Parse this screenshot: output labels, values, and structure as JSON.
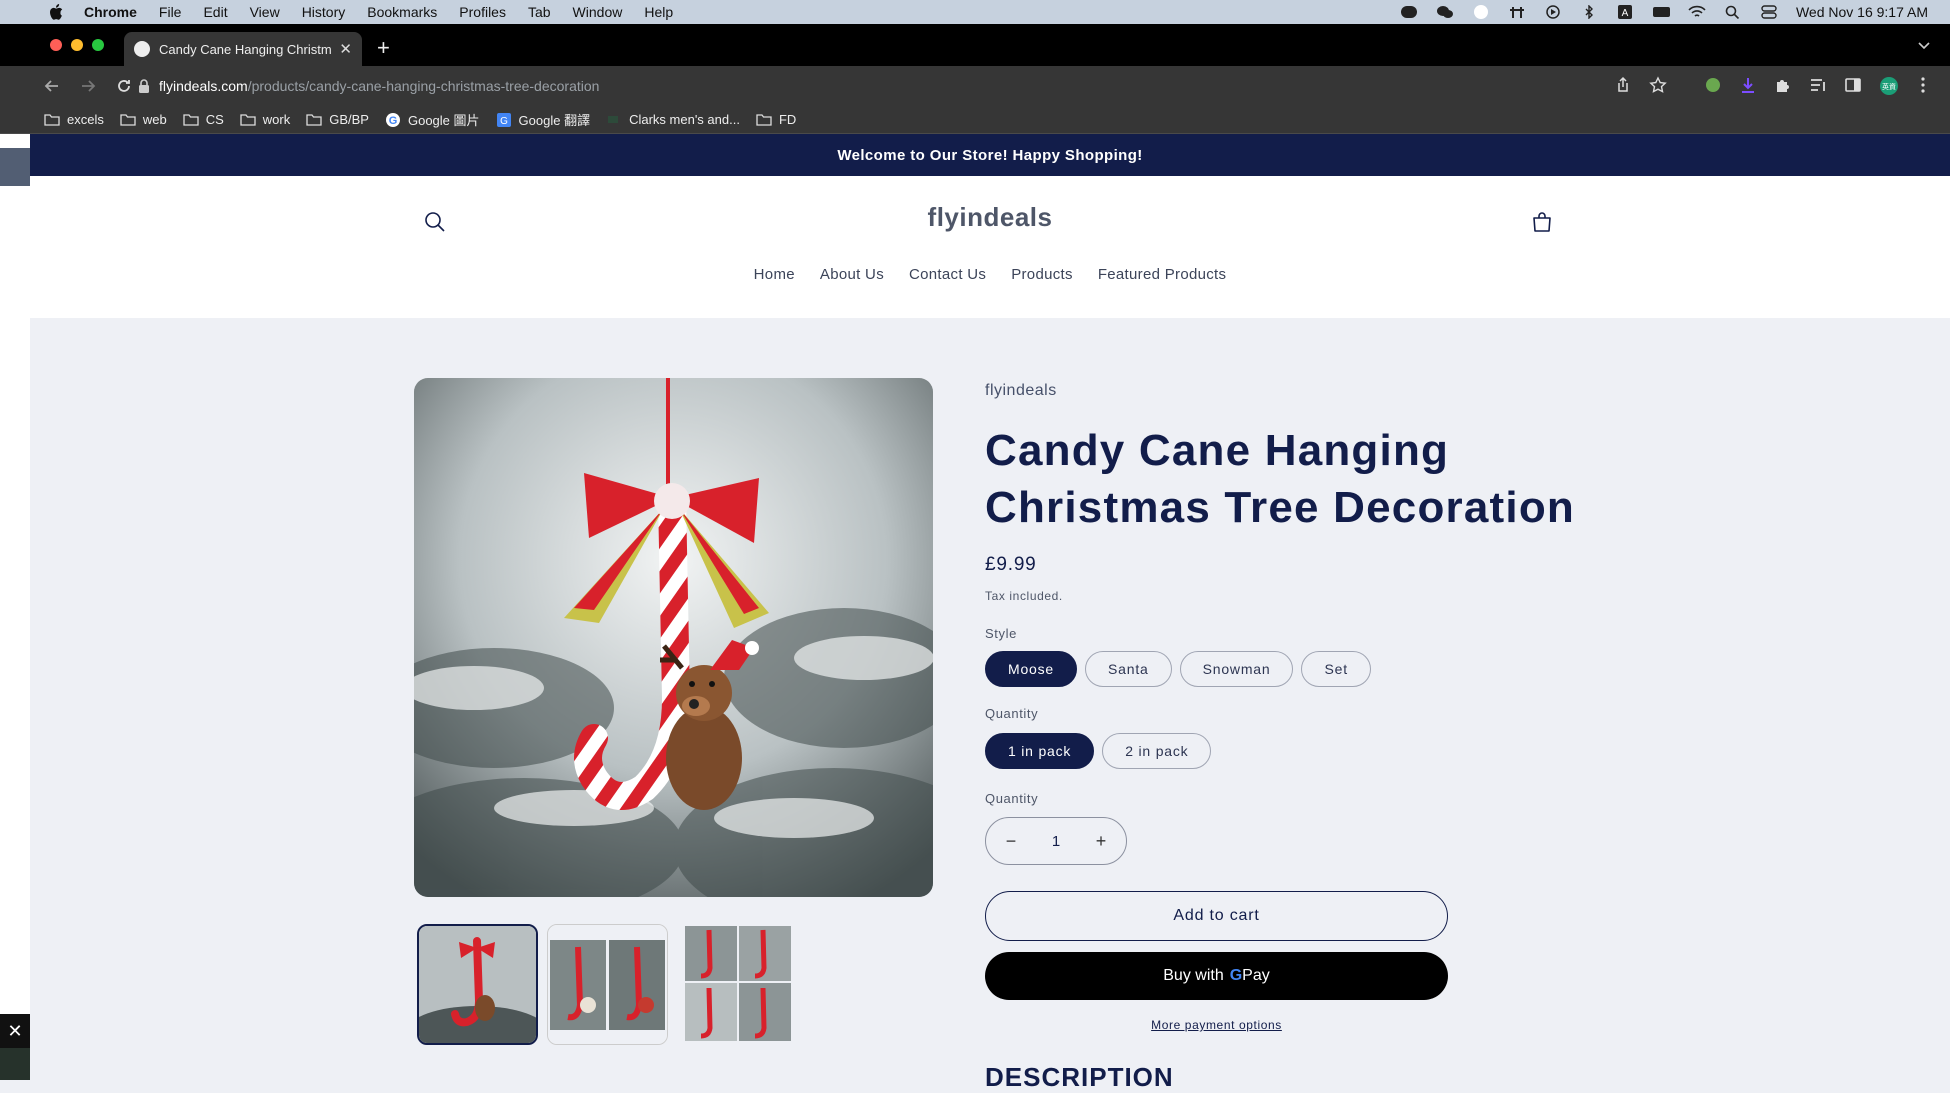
{
  "menubar": {
    "app": "Chrome",
    "items": [
      "File",
      "Edit",
      "View",
      "History",
      "Bookmarks",
      "Profiles",
      "Tab",
      "Window",
      "Help"
    ],
    "datetime": "Wed Nov 16  9:17 AM"
  },
  "browser": {
    "tab_title": "Candy Cane Hanging Christmas Tree Decoration",
    "url_host": "flyindeals.com",
    "url_path": "/products/candy-cane-hanging-christmas-tree-decoration",
    "profile_badge": "英資",
    "bookmarks": [
      "excels",
      "web",
      "CS",
      "work",
      "GB/BP",
      "Google 圖片",
      "Google 翻譯",
      "Clarks men's and...",
      "FD"
    ]
  },
  "store": {
    "announcement": "Welcome to Our Store! Happy Shopping!",
    "logo": "flyindeals",
    "nav": [
      "Home",
      "About Us",
      "Contact Us",
      "Products",
      "Featured Products"
    ]
  },
  "product": {
    "vendor": "flyindeals",
    "title": "Candy Cane Hanging Christmas Tree Decoration",
    "price": "£9.99",
    "tax_note": "Tax included.",
    "style_label": "Style",
    "styles": [
      "Moose",
      "Santa",
      "Snowman",
      "Set"
    ],
    "selected_style": "Moose",
    "pack_label": "Quantity",
    "packs": [
      "1 in pack",
      "2 in pack"
    ],
    "selected_pack": "1 in pack",
    "quantity_label": "Quantity",
    "quantity": "1",
    "add_to_cart": "Add to cart",
    "buy_with": "Buy with",
    "gpay_g": "G",
    "gpay_pay": "Pay",
    "more_payment": "More payment options",
    "description_heading": "DESCRIPTION"
  },
  "colors": {
    "brand_navy": "#121d4a",
    "page_bg": "#eef0f5",
    "candy_red": "#d8212b"
  }
}
